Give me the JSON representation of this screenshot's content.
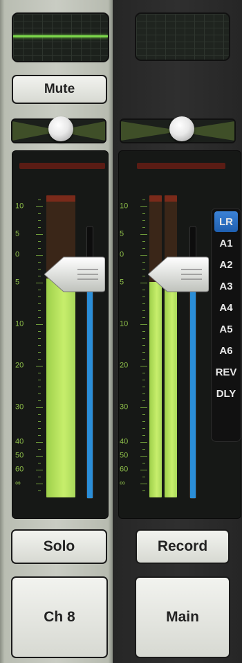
{
  "ch8": {
    "mute_label": "Mute",
    "solo_label": "Solo",
    "name_label": "Ch 8",
    "pan_position": 0.5,
    "fader_level_db": 0,
    "meter_level_db": 0
  },
  "main": {
    "record_label": "Record",
    "name_label": "Main",
    "pan_position": 0.5,
    "fader_level_db": 0
  },
  "scale_labels": [
    "10",
    "5",
    "0",
    "5",
    "10",
    "20",
    "30",
    "40",
    "50",
    "60",
    "∞"
  ],
  "bus_selector": {
    "items": [
      "LR",
      "A1",
      "A2",
      "A3",
      "A4",
      "A5",
      "A6",
      "REV",
      "DLY"
    ],
    "selected": "LR"
  },
  "colors": {
    "meter_green": "#a8dc52",
    "send_blue": "#2a8ed8",
    "selected_blue": "#2f72c8",
    "eq_curve": "#7bd64a"
  }
}
